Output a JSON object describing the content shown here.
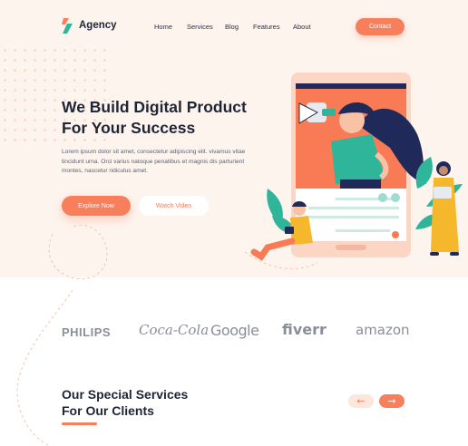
{
  "header": {
    "logo_text": "Agency",
    "nav": [
      "Home",
      "Services",
      "Blog",
      "Features",
      "About"
    ],
    "contact_label": "Contact"
  },
  "hero": {
    "headline_line1": "We Build Digital Product",
    "headline_line2": "For Your Success",
    "description": "Lorem ipsum dolor sit amet, consectetur adipiscing elit. vivamus vitae tincidunt urna. Orci varius natoque penatibus et magnis dis parturient montes, nascetur ridiculus amet.",
    "primary_button": "Explore Now",
    "secondary_button": "Watch Video"
  },
  "brands": [
    "PHILIPS",
    "Coca-Cola",
    "Google",
    "fiverr",
    "amazon"
  ],
  "services": {
    "title_line1": "Our Special Services",
    "title_line2": "For Our Clients",
    "prev_icon": "←",
    "next_icon": "→"
  },
  "colors": {
    "accent": "#f77f5b",
    "hero_bg": "#fdf4ee",
    "teal": "#2fb69a",
    "navy": "#1f2536"
  }
}
